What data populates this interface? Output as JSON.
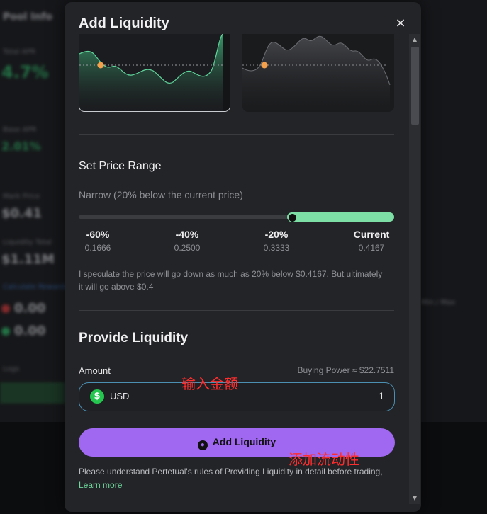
{
  "background": {
    "title": "Pool Info",
    "labels": [
      "Total APR",
      "Base APR",
      "Mark Price",
      "Liquidity Total",
      "Calculate Rewards"
    ],
    "big_value": "4.7%",
    "mid_value": "2.01%",
    "mark_price": "$0.41",
    "liquidity": "$1.11M",
    "row1_value": "0.00",
    "row2_value": "0.00",
    "right_text": "Min / Max",
    "bottom_label": "Logs"
  },
  "modal": {
    "title": "Add Liquidity",
    "close_glyph": "×"
  },
  "price_range": {
    "heading": "Set Price Range",
    "selection_desc": "Narrow (20% below the current price)",
    "slider_fill_start_fraction": 0.66,
    "ticks": [
      {
        "pct": "-60%",
        "price": "0.1666"
      },
      {
        "pct": "-40%",
        "price": "0.2500"
      },
      {
        "pct": "-20%",
        "price": "0.3333"
      },
      {
        "pct": "Current",
        "price": "0.4167"
      }
    ],
    "speculation_text": "I speculate the price will go down as much as 20% below $0.4167. But ultimately it will go above $0.4"
  },
  "provide": {
    "heading": "Provide Liquidity",
    "amount_label": "Amount",
    "buying_power": "Buying Power ≈ $22.7511",
    "currency_symbol": "$",
    "currency": "USD",
    "amount_value": "1",
    "button_label": "Add Liquidity",
    "terms_text": "Please understand Pertetual's rules of Providing Liquidity in detail before trading, ",
    "learn_more": "Learn more"
  },
  "annotations": {
    "enter_amount": "输入金额",
    "add_liquidity": "添加流动性"
  },
  "colors": {
    "accent_green": "#7ddfa5",
    "button_purple": "#a068f0",
    "annotation_red": "#ff2d2d",
    "marker_orange": "#f5a04a"
  }
}
